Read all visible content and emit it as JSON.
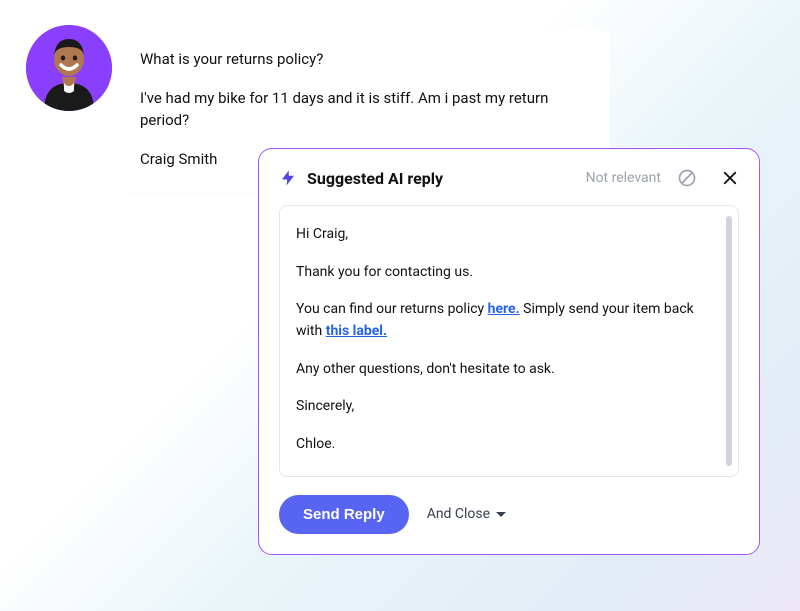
{
  "message": {
    "line1": "What is your returns policy?",
    "line2": "I've had my bike for 11 days and it is stiff. Am i past my return period?",
    "sender": "Craig Smith"
  },
  "reply_panel": {
    "title": "Suggested AI reply",
    "not_relevant_label": "Not relevant",
    "body": {
      "greeting": "Hi Craig,",
      "line1": "Thank you for contacting us.",
      "line2_a": "You can find our returns policy ",
      "link1": "here.",
      "line2_b": " Simply send your item back with ",
      "link2": "this label.",
      "line3": "Any other questions, don't hesitate to ask.",
      "closing": "Sincerely,",
      "signature": "Chloe."
    },
    "send_label": "Send Reply",
    "and_close_label": "And Close"
  }
}
